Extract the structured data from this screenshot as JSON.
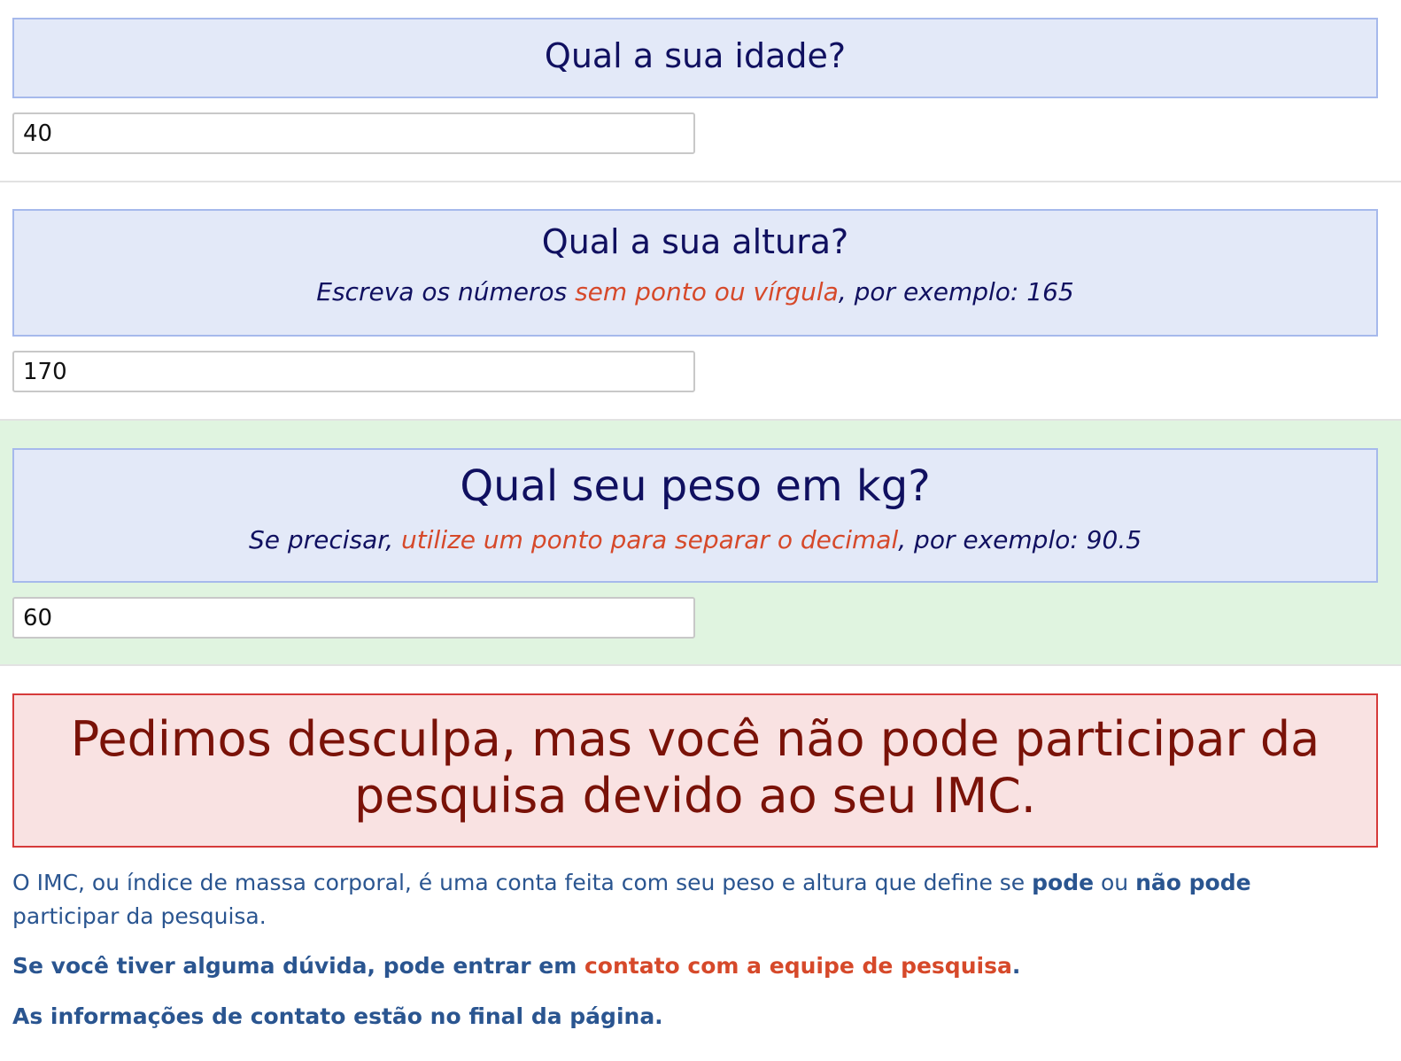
{
  "questions": {
    "age": {
      "title": "Qual a sua idade?",
      "value": "40"
    },
    "height": {
      "title": "Qual a sua altura?",
      "hint_before": "Escreva os números ",
      "hint_highlight": "sem ponto ou vírgula",
      "hint_after": ", por exemplo: 165",
      "value": "170"
    },
    "weight": {
      "title": "Qual seu peso em kg?",
      "hint_before": "Se precisar, ",
      "hint_highlight": "utilize um ponto para separar o decimal",
      "hint_after": ", por exemplo: 90.5",
      "value": "60"
    }
  },
  "alert": {
    "message": "Pedimos desculpa, mas você não pode participar da pesquisa devido ao seu IMC."
  },
  "info": {
    "p1_text": "O IMC, ou índice de massa corporal, é uma conta feita com seu peso e altura que define se ",
    "p1_bold1": "pode",
    "p1_mid": " ou ",
    "p1_bold2": "não pode",
    "p1_end": " participar da pesquisa.",
    "p2_text": "Se você tiver alguma dúvida, pode entrar em ",
    "p2_link": "contato com a equipe de pesquisa",
    "p2_end": ".",
    "p3_text": "As informações de contato estão no final da página."
  },
  "colors": {
    "question_bg": "#e3e9f8",
    "question_border": "#a6b9ec",
    "question_text": "#101060",
    "highlight_section_bg": "#e0f4e0",
    "hint_highlight": "#d6492a",
    "alert_bg": "#f9e2e2",
    "alert_border": "#d63a3a",
    "alert_text": "#7a1208",
    "info_text": "#2a5590"
  }
}
